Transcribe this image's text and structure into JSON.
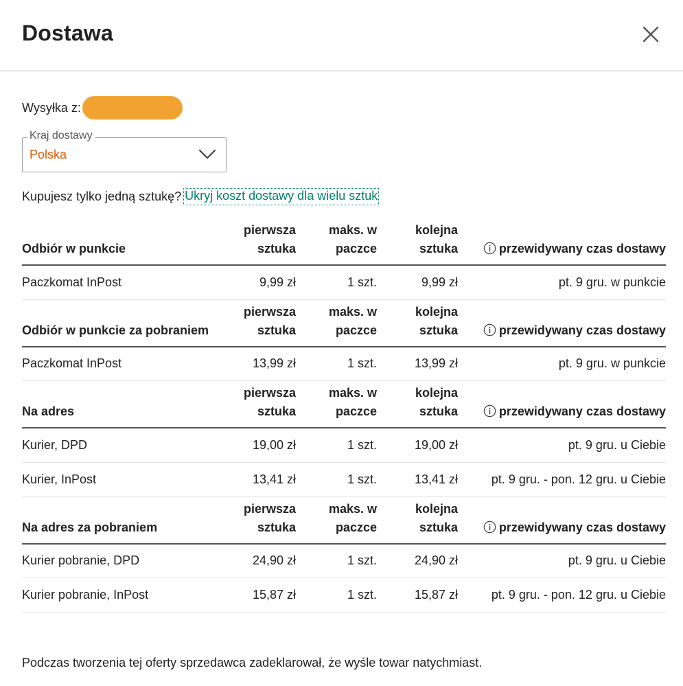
{
  "dialog": {
    "title": "Dostawa",
    "close_icon": "close-icon"
  },
  "shipping_from": {
    "label": "Wysyłka z:",
    "redaction_color": "#f2a230"
  },
  "country_select": {
    "legend": "Kraj dostawy",
    "value": "Polska",
    "value_color": "#e05a00",
    "chevron_icon": "chevron-down-icon"
  },
  "multi_items": {
    "question": "Kupujesz tylko jedną sztukę?",
    "link_label": "Ukryj koszt dostawy dla wielu sztuk",
    "link_color": "#00806a"
  },
  "columns": {
    "first_item_line1": "pierwsza",
    "first_item_line2": "sztuka",
    "max_pack_line1": "maks. w",
    "max_pack_line2": "paczce",
    "next_item_line1": "kolejna",
    "next_item_line2": "sztuka",
    "delivery_time": "przewidywany czas dostawy",
    "info_icon": "info-icon"
  },
  "groups": [
    {
      "title": "Odbiór w punkcie",
      "rows": [
        {
          "name": "Paczkomat InPost",
          "first": "9,99 zł",
          "max": "1 szt.",
          "next": "9,99 zł",
          "eta": "pt. 9 gru. w punkcie"
        }
      ]
    },
    {
      "title": "Odbiór w punkcie za pobraniem",
      "rows": [
        {
          "name": "Paczkomat InPost",
          "first": "13,99 zł",
          "max": "1 szt.",
          "next": "13,99 zł",
          "eta": "pt. 9 gru. w punkcie"
        }
      ]
    },
    {
      "title": "Na adres",
      "rows": [
        {
          "name": "Kurier, DPD",
          "first": "19,00 zł",
          "max": "1 szt.",
          "next": "19,00 zł",
          "eta": "pt. 9 gru. u Ciebie"
        },
        {
          "name": "Kurier, InPost",
          "first": "13,41 zł",
          "max": "1 szt.",
          "next": "13,41 zł",
          "eta": "pt. 9 gru. - pon. 12 gru. u Ciebie"
        }
      ]
    },
    {
      "title": "Na adres za pobraniem",
      "rows": [
        {
          "name": "Kurier pobranie, DPD",
          "first": "24,90 zł",
          "max": "1 szt.",
          "next": "24,90 zł",
          "eta": "pt. 9 gru. u Ciebie"
        },
        {
          "name": "Kurier pobranie, InPost",
          "first": "15,87 zł",
          "max": "1 szt.",
          "next": "15,87 zł",
          "eta": "pt. 9 gru. - pon. 12 gru. u Ciebie"
        }
      ]
    }
  ],
  "footer_note": "Podczas tworzenia tej oferty sprzedawca zadeklarował, że wyśle towar natychmiast."
}
